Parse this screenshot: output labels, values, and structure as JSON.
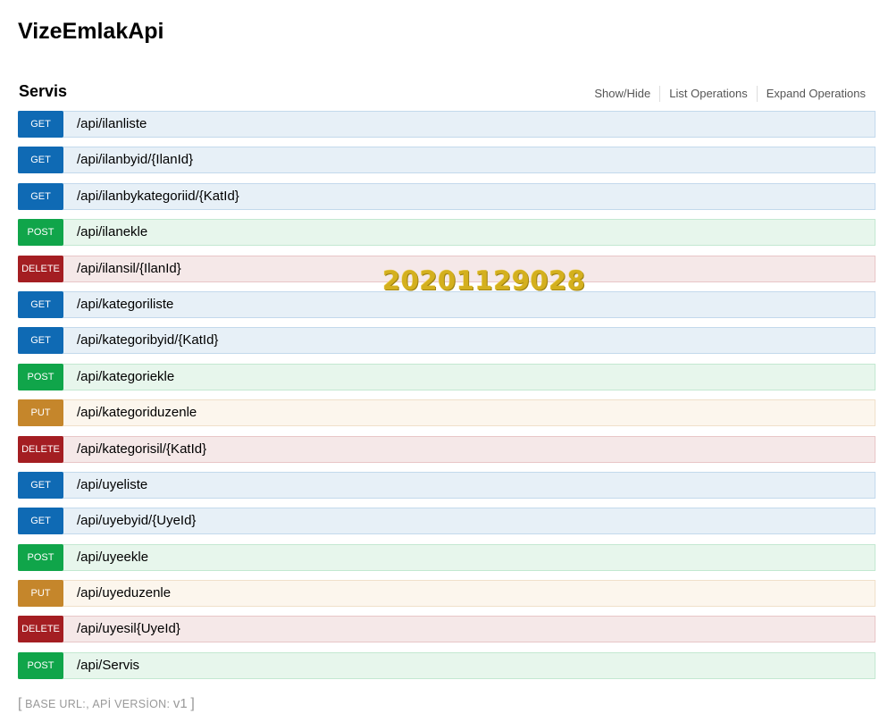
{
  "app": {
    "title": "VizeEmlakApi"
  },
  "resource": {
    "name": "Servis",
    "options": [
      {
        "label": "Show/Hide"
      },
      {
        "label": "List Operations"
      },
      {
        "label": "Expand Operations"
      }
    ]
  },
  "endpoints": [
    {
      "method": "GET",
      "path": "/api/ilanliste"
    },
    {
      "method": "GET",
      "path": "/api/ilanbyid/{IlanId}"
    },
    {
      "method": "GET",
      "path": "/api/ilanbykategoriid/{KatId}"
    },
    {
      "method": "POST",
      "path": "/api/ilanekle"
    },
    {
      "method": "DELETE",
      "path": "/api/ilansil/{IlanId}"
    },
    {
      "method": "GET",
      "path": "/api/kategoriliste"
    },
    {
      "method": "GET",
      "path": "/api/kategoribyid/{KatId}"
    },
    {
      "method": "POST",
      "path": "/api/kategoriekle"
    },
    {
      "method": "PUT",
      "path": "/api/kategoriduzenle"
    },
    {
      "method": "DELETE",
      "path": "/api/kategorisil/{KatId}"
    },
    {
      "method": "GET",
      "path": "/api/uyeliste"
    },
    {
      "method": "GET",
      "path": "/api/uyebyid/{UyeId}"
    },
    {
      "method": "POST",
      "path": "/api/uyeekle"
    },
    {
      "method": "PUT",
      "path": "/api/uyeduzenle"
    },
    {
      "method": "DELETE",
      "path": "/api/uyesil{UyeId}"
    },
    {
      "method": "POST",
      "path": "/api/Servis"
    }
  ],
  "watermark": {
    "text": "20201129028"
  },
  "footer": {
    "open_bracket": "[",
    "base_url_label": "BASE URL:",
    "separator": ", ",
    "api_version_label": "APİ VERSİON:",
    "api_version_value": "v1",
    "close_bracket": "]"
  },
  "colors": {
    "get": "#0f6ab4",
    "post": "#10a54a",
    "delete": "#a41e22",
    "put": "#c5862b",
    "watermark": "#d4b01e"
  }
}
